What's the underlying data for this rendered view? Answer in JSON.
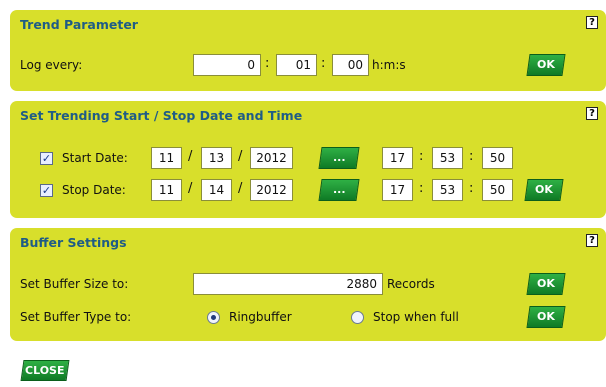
{
  "trend": {
    "title": "Trend Parameter",
    "log_label": "Log every:",
    "hours": "0",
    "minutes": "01",
    "seconds": "00",
    "unit": "h:m:s",
    "ok": "OK"
  },
  "schedule": {
    "title": "Set Trending Start / Stop Date and Time",
    "start": {
      "checked": true,
      "label": "Start Date:",
      "month": "11",
      "day": "13",
      "year": "2012",
      "hour": "17",
      "minute": "53",
      "second": "50"
    },
    "stop": {
      "checked": true,
      "label": "Stop Date:",
      "month": "11",
      "day": "14",
      "year": "2012",
      "hour": "17",
      "minute": "53",
      "second": "50"
    },
    "picker": "...",
    "ok": "OK"
  },
  "buffer": {
    "title": "Buffer Settings",
    "size_label": "Set Buffer Size to:",
    "size_value": "2880",
    "size_unit": "Records",
    "type_label": "Set Buffer Type to:",
    "type_options": [
      "Ringbuffer",
      "Stop when full"
    ],
    "type_selected": "Ringbuffer",
    "ok": "OK"
  },
  "help": "?",
  "close": "CLOSE",
  "separators": {
    "time": ":",
    "date": "/"
  },
  "colors": {
    "panel": "#d8df2b",
    "title": "#1f5c86",
    "button": "#17912f"
  }
}
